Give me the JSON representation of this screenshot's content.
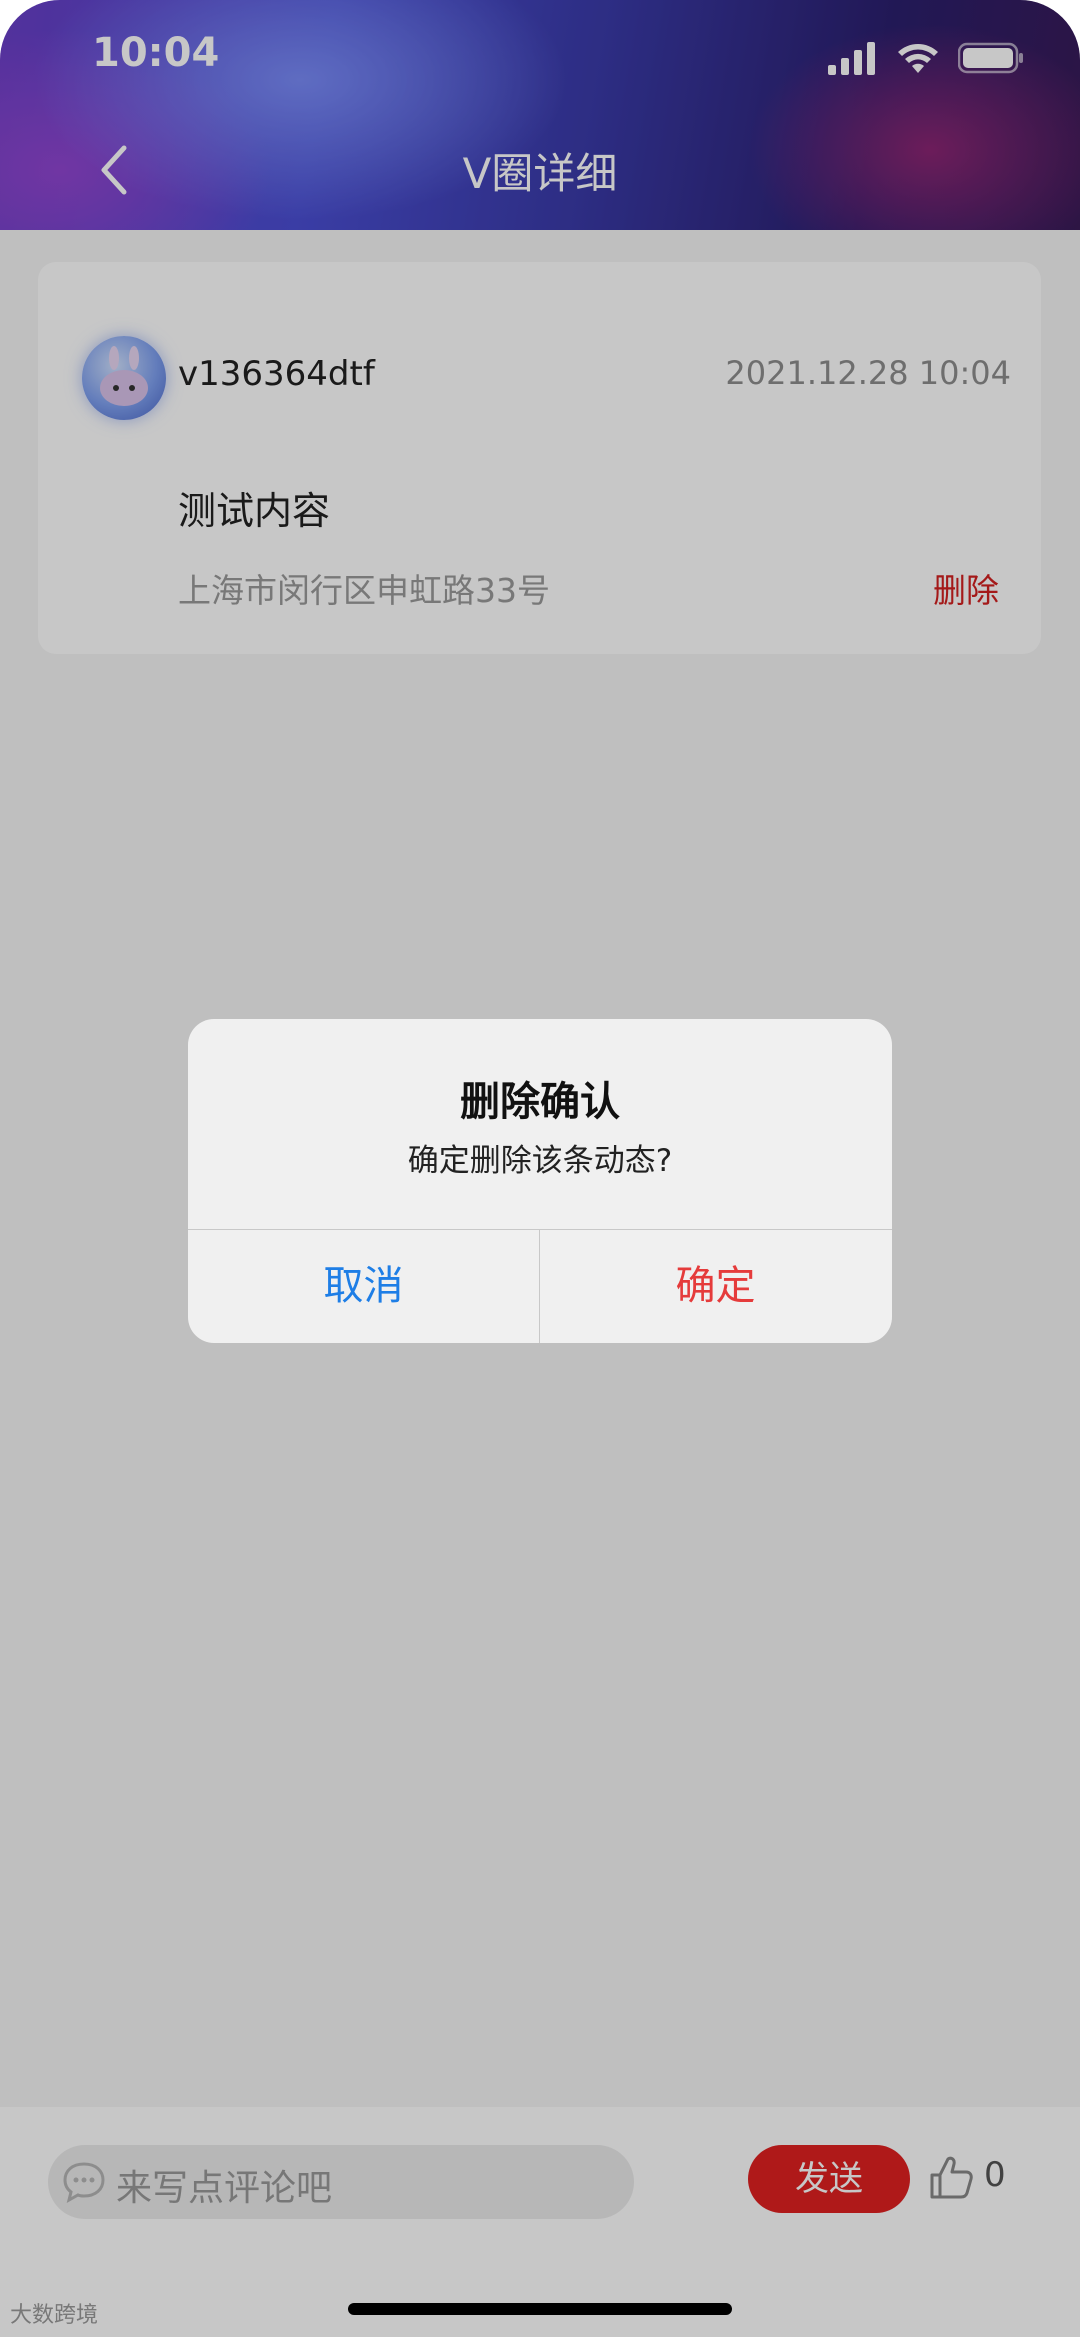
{
  "status_bar": {
    "time": "10:04"
  },
  "header": {
    "title": "V圈详细"
  },
  "post": {
    "username": "v136364dtf",
    "time": "2021.12.28 10:04",
    "content": "测试内容",
    "location": "上海市闵行区申虹路33号",
    "delete_label": "删除"
  },
  "dialog": {
    "title": "删除确认",
    "message": "确定删除该条动态?",
    "cancel_label": "取消",
    "confirm_label": "确定"
  },
  "bottom_bar": {
    "comment_placeholder": "来写点评论吧",
    "send_label": "发送",
    "like_count": "0"
  },
  "watermark": "大数跨境",
  "colors": {
    "accent_red": "#e02020",
    "cancel_blue": "#1e7ee6",
    "confirm_red": "#e53b3b"
  }
}
